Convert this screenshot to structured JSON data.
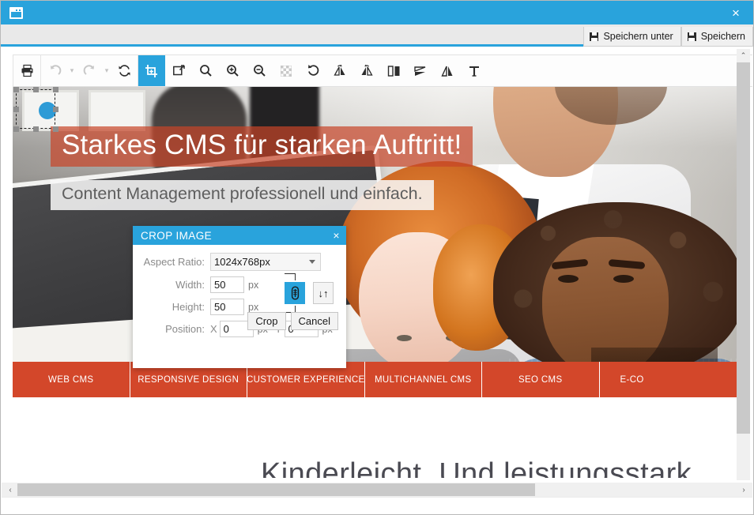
{
  "window": {
    "icon": "window-icon",
    "close_label": "×"
  },
  "command_bar": {
    "buttons": [
      {
        "label": "Speichern unter",
        "icon": "floppy-disk-icon"
      },
      {
        "label": "Speichern",
        "icon": "floppy-disk-icon"
      }
    ]
  },
  "toolbar": {
    "tools": [
      {
        "name": "print-icon",
        "title": "Drucken",
        "state": "enabled"
      },
      {
        "name": "undo-icon",
        "title": "Rückgängig",
        "state": "disabled"
      },
      {
        "name": "redo-icon",
        "title": "Wiederholen",
        "state": "disabled"
      },
      {
        "name": "reset-icon",
        "title": "Zurücksetzen",
        "state": "enabled"
      },
      {
        "name": "crop-icon",
        "title": "Zuschneiden",
        "state": "active"
      },
      {
        "name": "resize-icon",
        "title": "Größe ändern",
        "state": "enabled"
      },
      {
        "name": "zoom-fit-icon",
        "title": "Zoom anpassen",
        "state": "enabled"
      },
      {
        "name": "zoom-in-icon",
        "title": "Vergrößern",
        "state": "enabled"
      },
      {
        "name": "zoom-out-icon",
        "title": "Verkleinern",
        "state": "enabled"
      },
      {
        "name": "transparency-icon",
        "title": "Transparenz",
        "state": "disabled"
      },
      {
        "name": "rotate-icon",
        "title": "Drehen",
        "state": "enabled"
      },
      {
        "name": "rotate-left-icon",
        "title": "Links drehen",
        "state": "enabled"
      },
      {
        "name": "rotate-right-icon",
        "title": "Rechts drehen",
        "state": "enabled"
      },
      {
        "name": "flip-horizontal-icon",
        "title": "Horizontal spiegeln",
        "state": "enabled"
      },
      {
        "name": "flip-icon",
        "title": "Spiegeln",
        "state": "enabled"
      },
      {
        "name": "flip-vertical-icon",
        "title": "Vertikal spiegeln",
        "state": "enabled"
      },
      {
        "name": "text-icon",
        "title": "Text",
        "state": "enabled"
      }
    ]
  },
  "image": {
    "headline": "Starkes CMS für starken Auftritt!",
    "subheadline": "Content Management professionell und einfach.",
    "nav": [
      "WEB CMS",
      "RESPONSIVE DESIGN",
      "CUSTOMER EXPERIENCE",
      "MULTICHANNEL CMS",
      "SEO CMS",
      "E-CO"
    ],
    "section_heading": "Kinderleicht. Und leistungsstark.",
    "accent_color": "#d3472a",
    "headline_band_color": "#c84428"
  },
  "crop_dialog": {
    "title": "CROP IMAGE",
    "close_label": "×",
    "aspect_ratio": {
      "label": "Aspect Ratio:",
      "value": "1024x768px",
      "options": [
        "1024x768px"
      ]
    },
    "width": {
      "label": "Width:",
      "value": "50",
      "unit": "px"
    },
    "height": {
      "label": "Height:",
      "value": "50",
      "unit": "px"
    },
    "position": {
      "label": "Position:",
      "x_axis": "X",
      "x_value": "0",
      "x_unit": "px",
      "y_axis": "Y",
      "y_value": "0",
      "y_unit": "px"
    },
    "link_button": {
      "name": "link-aspect-icon",
      "active": true
    },
    "swap_button": {
      "name": "swap-dimensions-icon",
      "glyph": "↓↑"
    },
    "buttons": {
      "confirm": "Crop",
      "cancel": "Cancel"
    },
    "accent_color": "#29a3dc"
  },
  "scrollbars": {
    "vertical": {
      "up": "⌃",
      "down": "⌄"
    },
    "horizontal": {
      "left": "‹",
      "right": "›"
    }
  }
}
